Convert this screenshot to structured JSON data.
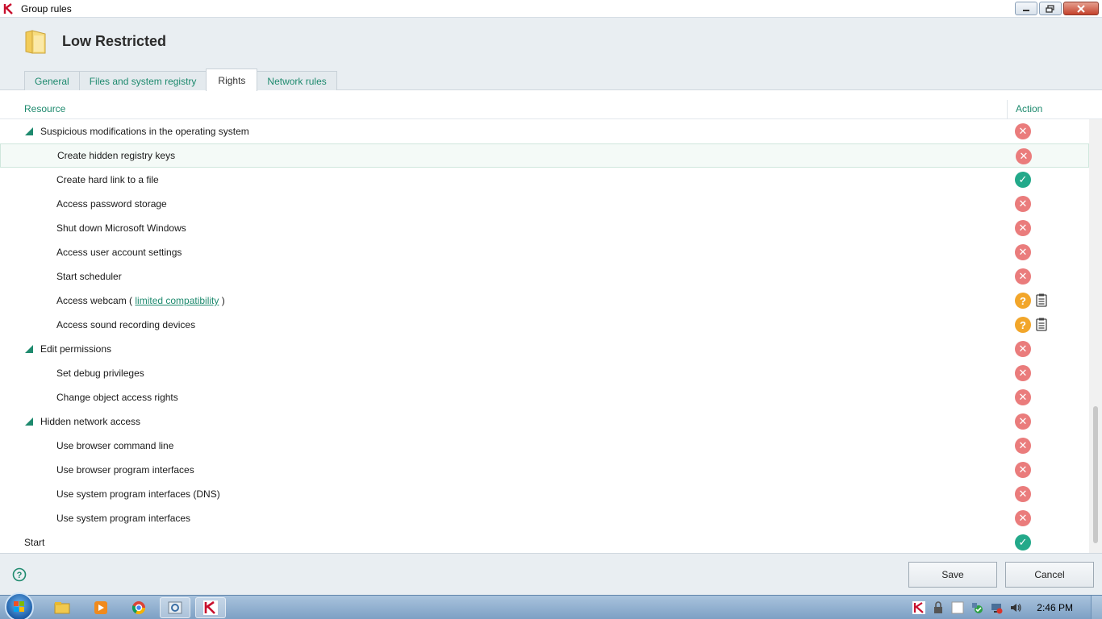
{
  "window": {
    "title": "Group rules"
  },
  "header": {
    "title": "Low Restricted"
  },
  "tabs": [
    {
      "label": "General",
      "active": false
    },
    {
      "label": "Files and system registry",
      "active": false
    },
    {
      "label": "Rights",
      "active": true
    },
    {
      "label": "Network rules",
      "active": false
    }
  ],
  "columns": {
    "resource": "Resource",
    "action": "Action"
  },
  "rows": [
    {
      "label": "Suspicious modifications in the operating system",
      "level": "group",
      "action": "deny"
    },
    {
      "label": "Create hidden registry keys",
      "level": "child",
      "action": "deny",
      "selected": true
    },
    {
      "label": "Create hard link to a file",
      "level": "child",
      "action": "allow"
    },
    {
      "label": "Access password storage",
      "level": "child",
      "action": "deny"
    },
    {
      "label": "Shut down Microsoft Windows",
      "level": "child",
      "action": "deny"
    },
    {
      "label": "Access user account settings",
      "level": "child",
      "action": "deny"
    },
    {
      "label": "Start scheduler",
      "level": "child",
      "action": "deny"
    },
    {
      "label": "Access webcam ( ",
      "link": "limited compatibility",
      "suffix": " )",
      "level": "child",
      "action": "ask",
      "log": true
    },
    {
      "label": "Access sound recording devices",
      "level": "child",
      "action": "ask",
      "log": true
    },
    {
      "label": "Edit permissions",
      "level": "group",
      "action": "deny"
    },
    {
      "label": "Set debug privileges",
      "level": "child",
      "action": "deny"
    },
    {
      "label": "Change object access rights",
      "level": "child",
      "action": "deny"
    },
    {
      "label": "Hidden network access",
      "level": "group",
      "action": "deny"
    },
    {
      "label": "Use browser command line",
      "level": "child",
      "action": "deny"
    },
    {
      "label": "Use browser program interfaces",
      "level": "child",
      "action": "deny"
    },
    {
      "label": "Use system program interfaces (DNS)",
      "level": "child",
      "action": "deny"
    },
    {
      "label": "Use system program interfaces",
      "level": "child",
      "action": "deny"
    },
    {
      "label": "Start",
      "level": "root",
      "action": "allow"
    }
  ],
  "footer": {
    "save_label": "Save",
    "cancel_label": "Cancel"
  },
  "taskbar": {
    "clock": "2:46 PM"
  },
  "colors": {
    "accent": "#1e8a6e",
    "deny": "#ea7c7c",
    "allow": "#23a98a",
    "ask": "#f2a62a"
  }
}
